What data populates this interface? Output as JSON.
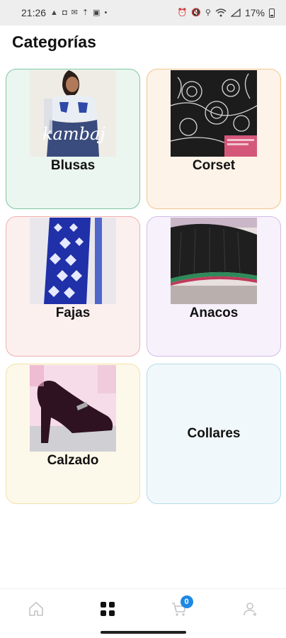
{
  "status_bar": {
    "time": "21:26",
    "battery": "17%",
    "icons_left": [
      "warning-icon",
      "cast-icon",
      "mail-icon",
      "upload-icon",
      "image-icon",
      "dot-icon"
    ],
    "icons_right": [
      "alarm-icon",
      "mute-icon",
      "location-icon",
      "wifi-icon",
      "signal-icon",
      "battery-icon"
    ]
  },
  "page": {
    "title": "Categorías"
  },
  "categories": [
    {
      "label": "Blusas",
      "border_color": "#7fc6a2",
      "bg_color": "#eaf6ef"
    },
    {
      "label": "Corset",
      "border_color": "#f3c48f",
      "bg_color": "#fdf3e8"
    },
    {
      "label": "Fajas",
      "border_color": "#eeb0ae",
      "bg_color": "#fcf0ef"
    },
    {
      "label": "Anacos",
      "border_color": "#d3bde6",
      "bg_color": "#f7f1fb"
    },
    {
      "label": "Calzado",
      "border_color": "#f3e0a6",
      "bg_color": "#fdf9ea"
    },
    {
      "label": "Collares",
      "border_color": "#b6dce9",
      "bg_color": "#f1f8fb"
    }
  ],
  "image_caption": {
    "blusas_watermark": "kambaj"
  },
  "bottom_nav": {
    "items": [
      "home-icon",
      "grid-icon",
      "cart-icon",
      "user-icon"
    ],
    "cart_count": "0",
    "active_color": "#111111",
    "inactive_color": "#c4c4c4",
    "badge_color": "#1e88e5"
  }
}
